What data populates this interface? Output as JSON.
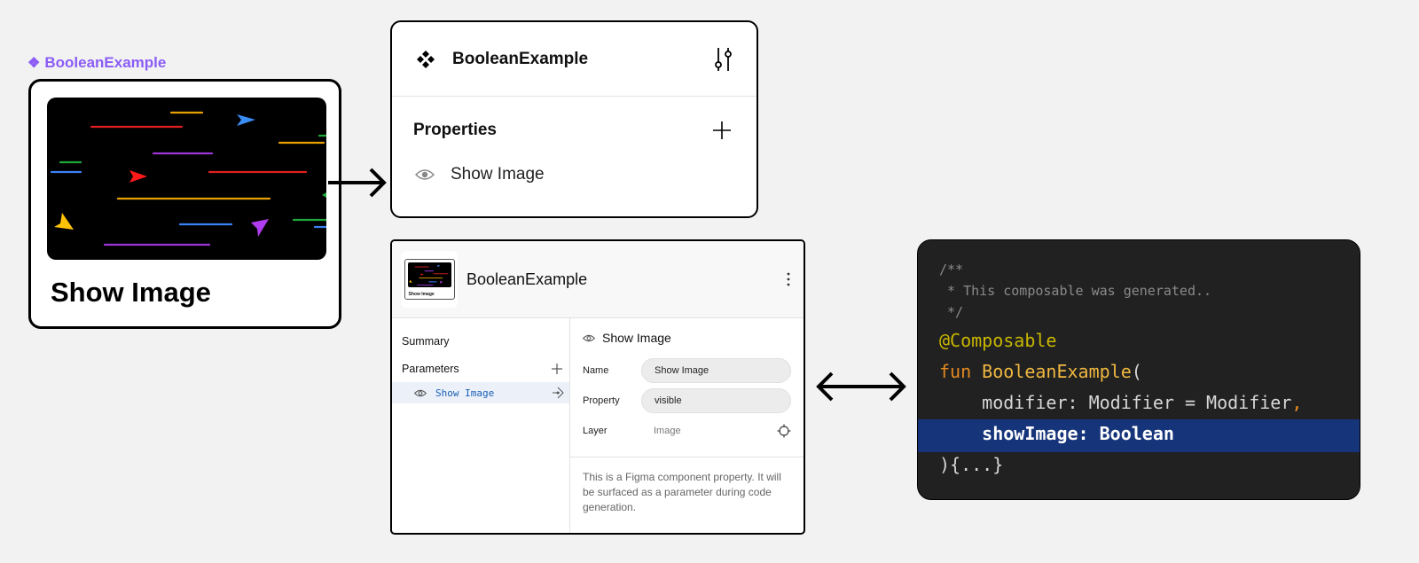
{
  "component": {
    "label_icon": "component-diamond-icon",
    "label": "BooleanExample",
    "card_title": "Show Image",
    "image": "colorful-arrows-on-black-image"
  },
  "figma_panel": {
    "component_icon": "component-icon",
    "title": "BooleanExample",
    "settings_icon": "tune-sliders-icon",
    "section_title": "Properties",
    "add_icon": "plus-icon",
    "property": {
      "icon": "eye-icon",
      "label": "Show Image"
    }
  },
  "relay_panel": {
    "thumbnail_caption": "Show Image",
    "title": "BooleanExample",
    "menu_icon": "more-vert-icon",
    "nav": {
      "summary": "Summary",
      "parameters": "Parameters",
      "selected_param": "Show Image"
    },
    "detail": {
      "title": "Show Image",
      "fields": [
        {
          "key": "Name",
          "value": "Show Image"
        },
        {
          "key": "Property",
          "value": "visible"
        },
        {
          "key": "Layer",
          "value": "Image"
        }
      ],
      "description": "This is a Figma component property. It will be surfaced as a parameter during code generation."
    }
  },
  "code": {
    "comment_open": "/**",
    "comment_body": " * This composable was generated..",
    "comment_close": " */",
    "annotation": "@Composable",
    "keyword": "fun",
    "function_name": "BooleanExample",
    "open_paren": "(",
    "param1_name": "    modifier: Modifier = Modifier",
    "param1_comma": ",",
    "param2": "    showImage: Boolean",
    "closing": "){...}"
  },
  "colors": {
    "accent_purple": "#8b5cf6",
    "code_bg": "#212121",
    "code_highlight": "#16347a",
    "annotation": "#c9b700",
    "keyword": "#e58a1f",
    "function": "#f0b840",
    "param_link": "#1a5fb4"
  }
}
